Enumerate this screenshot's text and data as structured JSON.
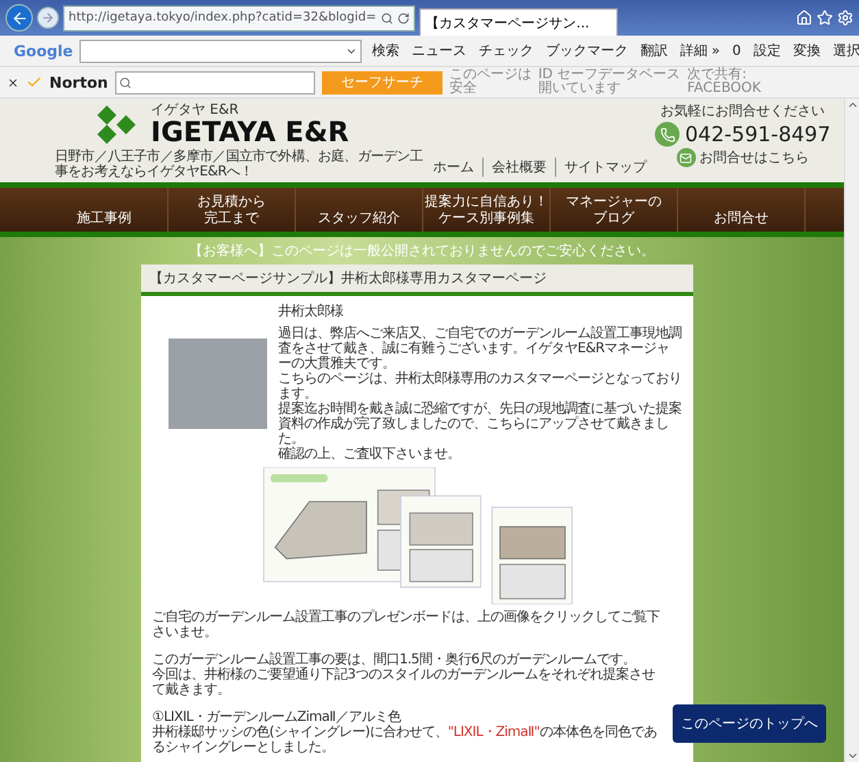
{
  "browser": {
    "address": "http://igetaya.tokyo/index.php?catid=32&blogid=",
    "tabs": [
      {
        "title": "【カスタマーページサン...",
        "selected": true
      }
    ],
    "google_toolbar": {
      "brand": "Google",
      "items": [
        {
          "label": "検索"
        },
        {
          "label": "ニュース"
        },
        {
          "label": "チェック"
        },
        {
          "label": "ブックマーク"
        },
        {
          "label": "翻訳"
        },
        {
          "label": "詳細 »"
        },
        {
          "label": "0"
        },
        {
          "label": "設定"
        },
        {
          "label": "変換"
        },
        {
          "label": "選択"
        }
      ]
    },
    "norton_toolbar": {
      "brand": "Norton",
      "search_button": "セーフサーチ",
      "items": [
        {
          "lines": [
            "このページは",
            "安全"
          ]
        },
        {
          "lines": [
            "ID セーフデータベース",
            "開いています"
          ]
        },
        {
          "lines": [
            "次で共有:",
            "FACEBOOK"
          ]
        }
      ]
    }
  },
  "header": {
    "logo_kana": "イゲタヤ E&R",
    "logo_name": "IGETAYA E&R",
    "tagline": "日野市／八王子市／多摩市／国立市で外構、お庭、ガーデン工事をお考えならイゲタヤE&Rへ！",
    "links": [
      "ホーム",
      "会社概要",
      "サイトマップ"
    ],
    "contact_label": "お気軽にお問合せください",
    "phone": "042-591-8497",
    "contact_link": "お問合せはこちら"
  },
  "nav": [
    {
      "lines": [
        "施工事例"
      ]
    },
    {
      "lines": [
        "お見積から",
        "完工まで"
      ]
    },
    {
      "lines": [
        "スタッフ紹介"
      ]
    },
    {
      "lines": [
        "提案力に自信あり！",
        "ケース別事例集"
      ]
    },
    {
      "lines": [
        "マネージャーの",
        "ブログ"
      ]
    },
    {
      "lines": [
        "お問合せ"
      ]
    }
  ],
  "notice": "【お客様へ】このページは一般公開されておりませんのでご安心ください。",
  "panel": {
    "title": "【カスタマーページサンプル】井桁太郎様専用カスタマーページ",
    "greeting": "井桁太郎様",
    "intro": [
      "過日は、弊店へご来店又、ご自宅でのガーデンルーム設置工事現地調査をさせて戴き、誠に有難うございます。イゲタヤE&Rマネージャーの大貫雅夫です。",
      "こちらのページは、井桁太郎様専用のカスタマーページとなっております。",
      "提案迄お時間を戴き誠に恐縮ですが、先日の現地調査に基づいた提案資料の作成が完了致しましたので、こちらにアップさせて戴きました。",
      "確認の上、ご査収下さいませ。"
    ],
    "body": [
      {
        "lines": [
          {
            "parts": [
              {
                "text": "ご自宅のガーデンルーム設置工事のプレゼンボードは、上の画像をクリックしてご覧下さいませ。",
                "highlight": false
              }
            ]
          }
        ]
      },
      {
        "lines": [
          {
            "parts": [
              {
                "text": "このガーデンルーム設置工事の要は、間口1.5間・奥行6尺のガーデンルームです。",
                "highlight": false
              }
            ]
          },
          {
            "parts": [
              {
                "text": "今回は、井桁様のご要望通り下記3つのスタイルのガーデンルームをそれぞれ提案させて戴きます。",
                "highlight": false
              }
            ]
          }
        ]
      },
      {
        "lines": [
          {
            "parts": [
              {
                "text": "①LIXIL・ガーデンルームZimaⅡ／アルミ色",
                "highlight": false
              }
            ]
          },
          {
            "parts": [
              {
                "text": "井桁様邸サッシの色(シャイングレー)に合わせて、",
                "highlight": false
              },
              {
                "text": "\"LIXIL・ZimaⅡ\"",
                "highlight": true
              },
              {
                "text": "の本体色を同色であるシャイングレーとしました。",
                "highlight": false
              }
            ]
          }
        ]
      }
    ]
  },
  "back_to_top": "このページのトップへ"
}
